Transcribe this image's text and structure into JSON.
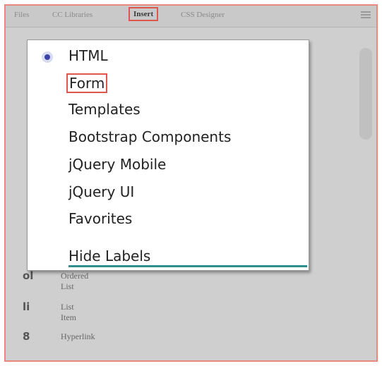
{
  "tabs": [
    {
      "label": "Files"
    },
    {
      "label": "CC Libraries"
    },
    {
      "label": "Insert"
    },
    {
      "label": "CSS Designer"
    }
  ],
  "dropdown": {
    "items": [
      {
        "label": "HTML"
      },
      {
        "label": "Form"
      },
      {
        "label": "Templates"
      },
      {
        "label": "Bootstrap Components"
      },
      {
        "label": "jQuery Mobile"
      },
      {
        "label": "jQuery UI"
      },
      {
        "label": "Favorites"
      }
    ],
    "hide_labels": "Hide Labels"
  },
  "panel_items": [
    {
      "icon": "ol",
      "label": "Ordered List"
    },
    {
      "icon": "li",
      "label": "List Item"
    },
    {
      "icon": "hyperlink-icon",
      "label": "Hyperlink"
    }
  ],
  "icon_glyphs": {
    "ordered_list": "ol",
    "list_item": "li",
    "hyperlink": "8"
  },
  "colors": {
    "highlight": "#e0564b",
    "accent_underline": "#2f8f8f",
    "radio": "#3a44a8"
  }
}
